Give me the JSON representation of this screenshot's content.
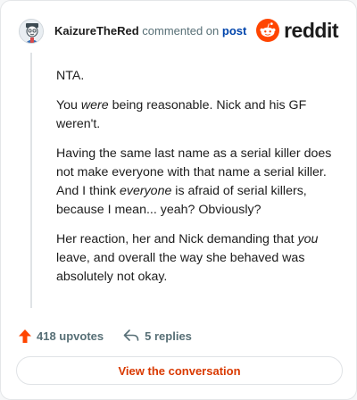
{
  "header": {
    "username": "KaizureTheRed",
    "commented_text": "commented on",
    "post_link": "post",
    "brand": "reddit"
  },
  "comment": {
    "p1": "NTA.",
    "p2_before": "You ",
    "p2_em": "were",
    "p2_after": " being reasonable. Nick and his GF weren't.",
    "p3_before": "Having the same last name as a serial killer does not make everyone with that name a serial killer. And I think ",
    "p3_em": "everyone",
    "p3_after": " is afraid of serial killers, because I mean... yeah? Obviously?",
    "p4_before": "Her reaction, her and Nick demanding that ",
    "p4_em": "you",
    "p4_after": " leave, and overall the way she behaved was absolutely not okay."
  },
  "actions": {
    "upvotes": "418 upvotes",
    "replies": "5 replies"
  },
  "conversation_button": "View the conversation",
  "colors": {
    "brand_orange": "#ff4500",
    "upvote": "#ff4500",
    "link_blue": "#0045ac",
    "button_text": "#d93900"
  },
  "icons": [
    "avatar",
    "reddit-snoo-icon",
    "upvote-arrow-icon",
    "reply-arrow-icon"
  ]
}
